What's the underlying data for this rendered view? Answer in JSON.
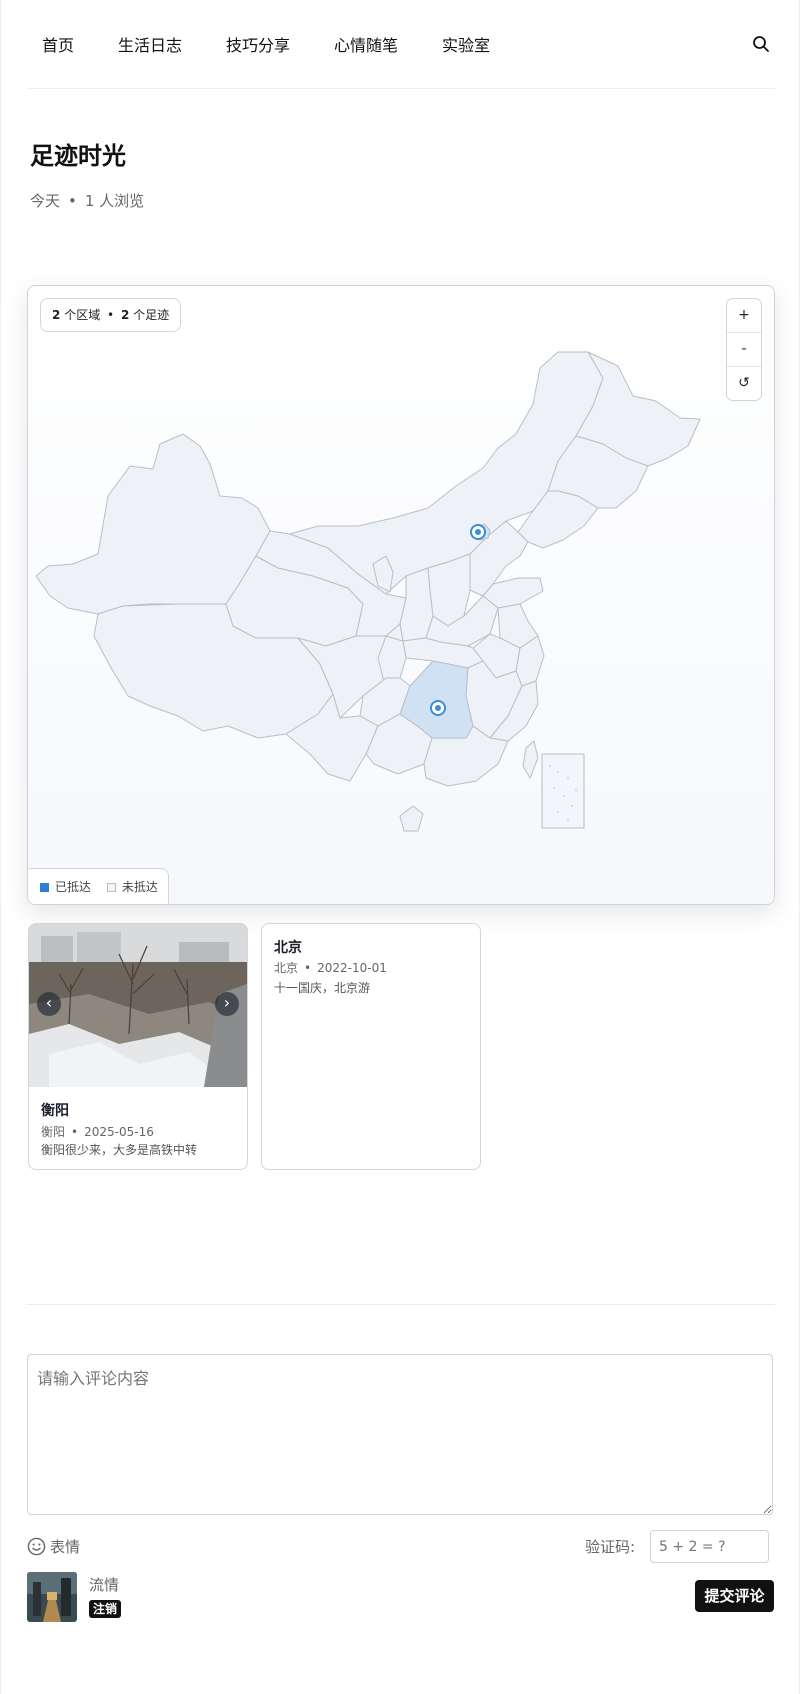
{
  "nav": {
    "items": [
      {
        "label": "首页"
      },
      {
        "label": "生活日志"
      },
      {
        "label": "技巧分享"
      },
      {
        "label": "心情随笔"
      },
      {
        "label": "实验室"
      }
    ],
    "search_icon": "search-icon"
  },
  "post": {
    "title": "足迹时光",
    "date": "今天",
    "separator": "•",
    "views": "1 人浏览"
  },
  "map": {
    "stats": {
      "regions_count": "2",
      "regions_label": "个区域",
      "separator": "•",
      "footprints_count": "2",
      "footprints_label": "个足迹"
    },
    "zoom_in": "+",
    "zoom_out": "-",
    "reset": "↺",
    "legend": {
      "visited": "已抵达",
      "unvisited": "未抵达"
    },
    "colors": {
      "visited_fill": "#cfe1f3",
      "province_fill": "#eef2f7",
      "border": "#b7bfca",
      "marker": "#3b8ed8"
    }
  },
  "footprints": [
    {
      "name": "衡阳",
      "place": "衡阳",
      "date": "2025-05-16",
      "desc": "衡阳很少来，大多是高铁中转",
      "prev": "‹",
      "next": "›"
    },
    {
      "name": "北京",
      "place": "北京",
      "date": "2022-10-01",
      "desc": "十一国庆，北京游"
    }
  ],
  "comments": {
    "placeholder": "请输入评论内容",
    "emoji_label": "表情",
    "captcha_label": "验证码:",
    "captcha_placeholder": "5 + 2 = ?",
    "user_name": "流情",
    "logout_label": "注销",
    "submit_label": "提交评论"
  }
}
